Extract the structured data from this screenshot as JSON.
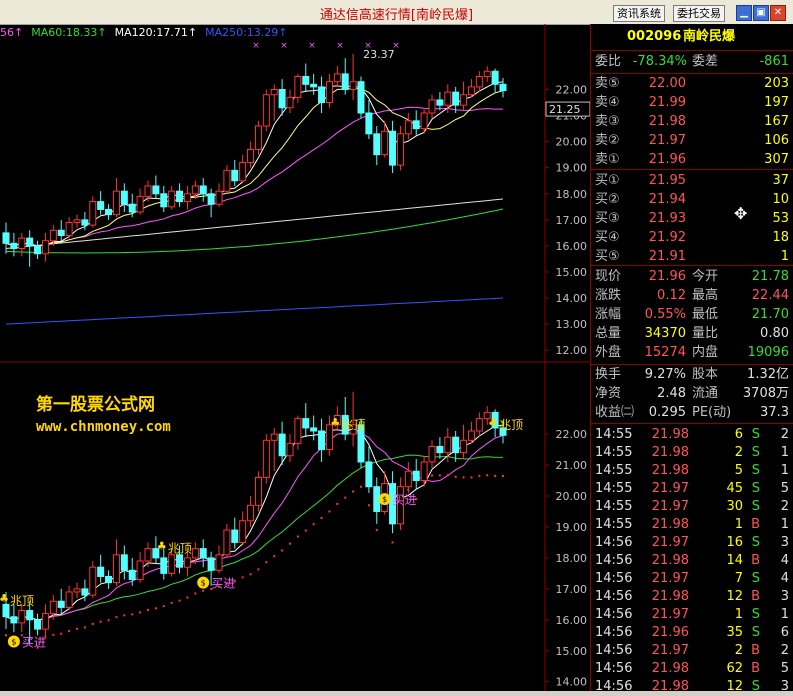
{
  "window": {
    "title": "通达信高速行情",
    "stock_tag": "[南岭民爆]",
    "btn_info": "资讯系统",
    "btn_order": "委托交易",
    "btn_minimize": "▁",
    "btn_restore": "▣",
    "btn_close": "✕"
  },
  "ma_legend": [
    {
      "text": "56↑",
      "color": "#ff55ff"
    },
    {
      "text": "MA60:18.33↑",
      "color": "#33dd33"
    },
    {
      "text": "MA120:17.71↑",
      "color": "#ffffff"
    },
    {
      "text": "MA250:13.29↑",
      "color": "#3355ff"
    }
  ],
  "chart_data": {
    "type": "candlestick",
    "upper": {
      "yticks": [
        "22.00",
        "21.00",
        "20.00",
        "19.00",
        "18.00",
        "17.00",
        "16.00",
        "15.00",
        "14.00",
        "13.00",
        "12.00"
      ],
      "ylim": [
        11.7,
        23.9
      ],
      "current_price_label": "21.25",
      "current_price": 21.25,
      "high_annotation": "23.37",
      "high_value": 23.37
    },
    "lower": {
      "yticks": [
        "22.00",
        "21.00",
        "20.00",
        "19.00",
        "18.00",
        "17.00",
        "16.00",
        "15.00",
        "14.00"
      ],
      "ylim": [
        13.7,
        24.2
      ],
      "markers": [
        {
          "text": "买进",
          "bar": 1,
          "price": 15.3
        },
        {
          "text": "兆顶",
          "bar": 0,
          "price": 16.6
        },
        {
          "text": "兆顶",
          "bar": 20,
          "price": 18.3
        },
        {
          "text": "买进",
          "bar": 25,
          "price": 17.2
        },
        {
          "text": "兆顶",
          "bar": 42,
          "price": 22.3
        },
        {
          "text": "买进",
          "bar": 48,
          "price": 19.9
        },
        {
          "text": "兆顶",
          "bar": 62,
          "price": 22.3
        }
      ]
    },
    "candles": [
      [
        16.5,
        16.1,
        16.9,
        15.7
      ],
      [
        16.1,
        15.9,
        16.5,
        15.6
      ],
      [
        15.9,
        16.3,
        16.5,
        15.6
      ],
      [
        16.3,
        16.0,
        16.6,
        15.2
      ],
      [
        16.0,
        15.7,
        16.2,
        15.5
      ],
      [
        15.7,
        16.2,
        16.5,
        15.4
      ],
      [
        16.2,
        16.6,
        16.8,
        16.0
      ],
      [
        16.6,
        16.4,
        17.0,
        16.2
      ],
      [
        16.4,
        16.9,
        17.1,
        16.3
      ],
      [
        16.9,
        17.0,
        17.2,
        16.7
      ],
      [
        17.0,
        16.8,
        17.3,
        16.6
      ],
      [
        16.8,
        17.7,
        17.9,
        16.7
      ],
      [
        17.7,
        17.4,
        18.1,
        17.2
      ],
      [
        17.4,
        17.2,
        17.6,
        17.0
      ],
      [
        17.2,
        18.1,
        18.6,
        17.1
      ],
      [
        18.1,
        17.6,
        18.4,
        17.3
      ],
      [
        17.6,
        17.3,
        18.0,
        17.1
      ],
      [
        17.3,
        17.9,
        18.2,
        17.2
      ],
      [
        17.9,
        18.3,
        18.5,
        17.7
      ],
      [
        18.3,
        18.0,
        18.7,
        17.8
      ],
      [
        18.0,
        17.5,
        18.3,
        17.3
      ],
      [
        17.5,
        18.1,
        18.3,
        17.4
      ],
      [
        18.1,
        17.7,
        18.4,
        17.5
      ],
      [
        17.7,
        18.0,
        18.3,
        17.4
      ],
      [
        18.0,
        18.3,
        18.5,
        17.8
      ],
      [
        18.3,
        18.0,
        18.6,
        17.7
      ],
      [
        18.0,
        17.6,
        18.2,
        17.1
      ],
      [
        17.6,
        18.1,
        18.4,
        17.5
      ],
      [
        18.1,
        18.9,
        19.1,
        18.0
      ],
      [
        18.9,
        18.5,
        19.3,
        18.3
      ],
      [
        18.5,
        19.2,
        19.5,
        18.4
      ],
      [
        19.2,
        19.7,
        20.0,
        19.0
      ],
      [
        19.7,
        20.6,
        20.8,
        19.5
      ],
      [
        20.6,
        21.8,
        22.0,
        20.4
      ],
      [
        21.8,
        22.0,
        22.2,
        20.8
      ],
      [
        22.0,
        21.3,
        22.4,
        21.0
      ],
      [
        21.3,
        21.7,
        22.0,
        21.1
      ],
      [
        21.7,
        22.5,
        22.6,
        21.5
      ],
      [
        22.5,
        22.2,
        23.0,
        21.9
      ],
      [
        22.2,
        22.1,
        22.6,
        21.8
      ],
      [
        22.1,
        21.5,
        22.5,
        21.1
      ],
      [
        21.5,
        22.3,
        22.6,
        21.3
      ],
      [
        22.3,
        22.6,
        22.9,
        22.1
      ],
      [
        22.6,
        22.0,
        23.2,
        21.8
      ],
      [
        22.0,
        22.3,
        23.37,
        21.6
      ],
      [
        22.3,
        21.1,
        22.5,
        20.9
      ],
      [
        21.1,
        20.3,
        21.6,
        20.1
      ],
      [
        20.3,
        19.5,
        20.6,
        19.1
      ],
      [
        19.5,
        20.4,
        20.8,
        19.4
      ],
      [
        20.4,
        19.1,
        20.8,
        18.8
      ],
      [
        19.1,
        20.3,
        20.6,
        18.9
      ],
      [
        20.3,
        20.8,
        21.1,
        20.1
      ],
      [
        20.8,
        20.5,
        21.2,
        20.2
      ],
      [
        20.5,
        21.1,
        21.3,
        20.3
      ],
      [
        21.1,
        21.6,
        21.8,
        20.9
      ],
      [
        21.6,
        21.4,
        21.9,
        21.2
      ],
      [
        21.4,
        21.9,
        22.2,
        21.1
      ],
      [
        21.9,
        21.4,
        22.1,
        21.1
      ],
      [
        21.4,
        21.8,
        22.3,
        21.2
      ],
      [
        21.8,
        22.1,
        22.4,
        21.7
      ],
      [
        22.1,
        22.5,
        22.7,
        21.9
      ],
      [
        22.5,
        22.7,
        22.9,
        22.3
      ],
      [
        22.7,
        22.2,
        22.8,
        21.9
      ],
      [
        22.2,
        21.96,
        22.44,
        21.7
      ]
    ]
  },
  "quote": {
    "code": "002096",
    "name": "南岭民爆",
    "wb_label": "委比",
    "wb_value": "-78.34%",
    "wc_label": "委差",
    "wc_value": "-861",
    "sells": [
      {
        "label": "卖⑤",
        "price": "22.00",
        "vol": "203"
      },
      {
        "label": "卖④",
        "price": "21.99",
        "vol": "197"
      },
      {
        "label": "卖③",
        "price": "21.98",
        "vol": "167"
      },
      {
        "label": "卖②",
        "price": "21.97",
        "vol": "106"
      },
      {
        "label": "卖①",
        "price": "21.96",
        "vol": "307"
      }
    ],
    "buys": [
      {
        "label": "买①",
        "price": "21.95",
        "vol": "37"
      },
      {
        "label": "买②",
        "price": "21.94",
        "vol": "10"
      },
      {
        "label": "买③",
        "price": "21.93",
        "vol": "53"
      },
      {
        "label": "买④",
        "price": "21.92",
        "vol": "18"
      },
      {
        "label": "买⑤",
        "price": "21.91",
        "vol": "1"
      }
    ],
    "stats": [
      {
        "l1": "现价",
        "v1": "21.96",
        "c1": "red",
        "l2": "今开",
        "v2": "21.78",
        "c2": "green"
      },
      {
        "l1": "涨跌",
        "v1": "0.12",
        "c1": "red",
        "l2": "最高",
        "v2": "22.44",
        "c2": "red"
      },
      {
        "l1": "涨幅",
        "v1": "0.55%",
        "c1": "red",
        "l2": "最低",
        "v2": "21.70",
        "c2": "green"
      },
      {
        "l1": "总量",
        "v1": "34370",
        "c1": "yellow",
        "l2": "量比",
        "v2": "0.80",
        "c2": "white"
      },
      {
        "l1": "外盘",
        "v1": "15274",
        "c1": "red",
        "l2": "内盘",
        "v2": "19096",
        "c2": "green"
      }
    ],
    "stats2": [
      {
        "l1": "换手",
        "v1": "9.27%",
        "l2": "股本",
        "v2": "1.32亿"
      },
      {
        "l1": "净资",
        "v1": "2.48",
        "l2": "流通",
        "v2": "3708万"
      },
      {
        "l1": "收益㈡",
        "v1": "0.295",
        "l2": "PE(动)",
        "v2": "37.3"
      }
    ]
  },
  "ticks": [
    {
      "time": "14:55",
      "price": "21.98",
      "vol": "6",
      "bs": "S",
      "n": "2"
    },
    {
      "time": "14:55",
      "price": "21.98",
      "vol": "2",
      "bs": "S",
      "n": "1"
    },
    {
      "time": "14:55",
      "price": "21.98",
      "vol": "5",
      "bs": "S",
      "n": "1"
    },
    {
      "time": "14:55",
      "price": "21.97",
      "vol": "45",
      "bs": "S",
      "n": "5"
    },
    {
      "time": "14:55",
      "price": "21.97",
      "vol": "30",
      "bs": "S",
      "n": "2"
    },
    {
      "time": "14:55",
      "price": "21.98",
      "vol": "1",
      "bs": "B",
      "n": "1"
    },
    {
      "time": "14:56",
      "price": "21.97",
      "vol": "16",
      "bs": "S",
      "n": "3"
    },
    {
      "time": "14:56",
      "price": "21.98",
      "vol": "14",
      "bs": "B",
      "n": "4"
    },
    {
      "time": "14:56",
      "price": "21.97",
      "vol": "7",
      "bs": "S",
      "n": "4"
    },
    {
      "time": "14:56",
      "price": "21.98",
      "vol": "12",
      "bs": "B",
      "n": "3"
    },
    {
      "time": "14:56",
      "price": "21.97",
      "vol": "1",
      "bs": "S",
      "n": "1"
    },
    {
      "time": "14:56",
      "price": "21.96",
      "vol": "35",
      "bs": "S",
      "n": "6"
    },
    {
      "time": "14:56",
      "price": "21.97",
      "vol": "2",
      "bs": "B",
      "n": "2"
    },
    {
      "time": "14:56",
      "price": "21.98",
      "vol": "62",
      "bs": "B",
      "n": "5"
    },
    {
      "time": "14:56",
      "price": "21.98",
      "vol": "12",
      "bs": "S",
      "n": "3"
    }
  ],
  "watermark": {
    "line1": "第一股票公式网",
    "line2": "www.chnmoney.com"
  },
  "colors": {
    "up": "#ff3333",
    "down": "#54ffff",
    "ma5": "#ffffff",
    "ma10": "#ffff80",
    "ma20": "#ff55ff",
    "ma60": "#33dd33",
    "ma120": "#e0e0e0",
    "ma250": "#3355ff",
    "dots": "#ff3333"
  }
}
